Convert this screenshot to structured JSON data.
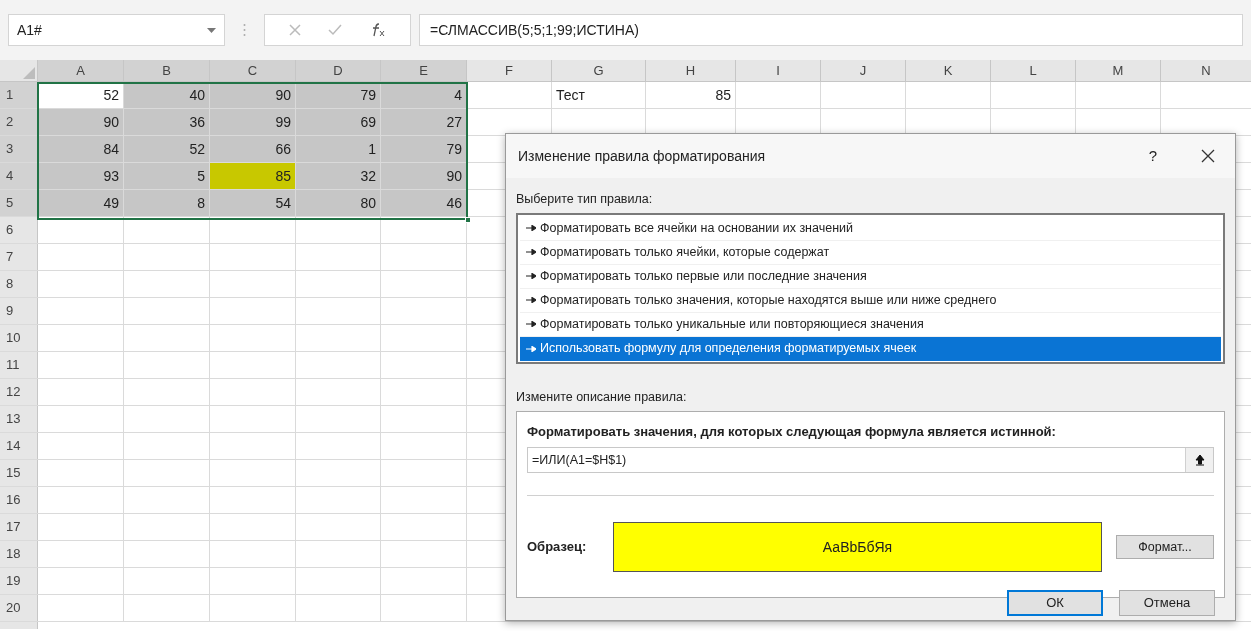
{
  "formula_bar": {
    "name_box": "A1#",
    "formula": "=СЛМАССИВ(5;5;1;99;ИСТИНА)"
  },
  "sheet": {
    "columns": [
      "A",
      "B",
      "C",
      "D",
      "E",
      "F",
      "G",
      "H",
      "I",
      "J",
      "K",
      "L",
      "M",
      "N"
    ],
    "rows": [
      {
        "number": "1",
        "cells": [
          {
            "value": "52",
            "kind": "number"
          },
          {
            "value": "40",
            "kind": "number",
            "selected": true
          },
          {
            "value": "90",
            "kind": "number",
            "selected": true
          },
          {
            "value": "79",
            "kind": "number",
            "selected": true
          },
          {
            "value": "4",
            "kind": "number",
            "selected": true
          },
          {},
          {
            "value": "Тест",
            "kind": "text"
          },
          {
            "value": "85",
            "kind": "number"
          }
        ]
      },
      {
        "number": "2",
        "cells": [
          {
            "value": "90",
            "kind": "number",
            "selected": true
          },
          {
            "value": "36",
            "kind": "number",
            "selected": true
          },
          {
            "value": "99",
            "kind": "number",
            "selected": true
          },
          {
            "value": "69",
            "kind": "number",
            "selected": true
          },
          {
            "value": "27",
            "kind": "number",
            "selected": true
          }
        ]
      },
      {
        "number": "3",
        "cells": [
          {
            "value": "84",
            "kind": "number",
            "selected": true
          },
          {
            "value": "52",
            "kind": "number",
            "selected": true
          },
          {
            "value": "66",
            "kind": "number",
            "selected": true
          },
          {
            "value": "1",
            "kind": "number",
            "selected": true
          },
          {
            "value": "79",
            "kind": "number",
            "selected": true
          }
        ]
      },
      {
        "number": "4",
        "cells": [
          {
            "value": "93",
            "kind": "number",
            "selected": true
          },
          {
            "value": "5",
            "kind": "number",
            "selected": true
          },
          {
            "value": "85",
            "kind": "number",
            "selected": true,
            "highlighted": true
          },
          {
            "value": "32",
            "kind": "number",
            "selected": true
          },
          {
            "value": "90",
            "kind": "number",
            "selected": true
          }
        ]
      },
      {
        "number": "5",
        "cells": [
          {
            "value": "49",
            "kind": "number",
            "selected": true
          },
          {
            "value": "8",
            "kind": "number",
            "selected": true
          },
          {
            "value": "54",
            "kind": "number",
            "selected": true
          },
          {
            "value": "80",
            "kind": "number",
            "selected": true
          },
          {
            "value": "46",
            "kind": "number",
            "selected": true
          }
        ]
      },
      {
        "number": "6"
      },
      {
        "number": "7"
      },
      {
        "number": "8"
      },
      {
        "number": "9"
      },
      {
        "number": "10"
      },
      {
        "number": "11"
      },
      {
        "number": "12"
      },
      {
        "number": "13"
      },
      {
        "number": "14"
      },
      {
        "number": "15"
      },
      {
        "number": "16"
      },
      {
        "number": "17"
      },
      {
        "number": "18"
      },
      {
        "number": "19"
      },
      {
        "number": "20"
      }
    ]
  },
  "dialog": {
    "title": "Изменение правила форматирования",
    "help": "?",
    "rule_type_label": "Выберите тип правила:",
    "rule_types": [
      {
        "label": "Форматировать все ячейки на основании их значений",
        "selected": false
      },
      {
        "label": "Форматировать только ячейки, которые содержат",
        "selected": false
      },
      {
        "label": "Форматировать только первые или последние значения",
        "selected": false
      },
      {
        "label": "Форматировать только значения, которые находятся выше или ниже среднего",
        "selected": false
      },
      {
        "label": "Форматировать только уникальные или повторяющиеся значения",
        "selected": false
      },
      {
        "label": "Использовать формулу для определения форматируемых ячеек",
        "selected": true
      }
    ],
    "description_label": "Измените описание правила:",
    "formula_label": "Форматировать значения, для которых следующая формула является истинной:",
    "formula": "=ИЛИ(A1=$H$1)",
    "preview": {
      "label": "Образец:",
      "text": "АаВbБбЯя",
      "color": "#ffff00"
    },
    "format_button": "Формат...",
    "buttons": [
      {
        "label": "ОК",
        "default": true
      },
      {
        "label": "Отмена",
        "default": false
      }
    ]
  }
}
